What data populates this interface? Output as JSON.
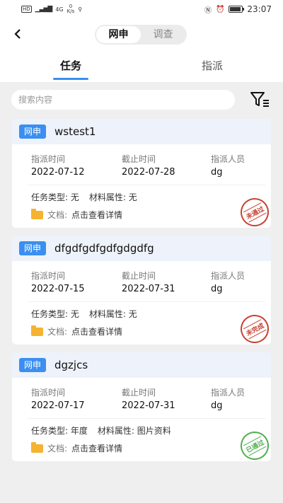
{
  "status_bar": {
    "hd": "HD",
    "signal": "4G",
    "speed": "0\nK/s",
    "time": "23:07"
  },
  "nav": {
    "back_icon": "chevron-left-icon",
    "segments": [
      "网申",
      "调查"
    ],
    "active_segment": 0
  },
  "tabs": [
    "任务",
    "指派"
  ],
  "search": {
    "placeholder": "搜索内容",
    "value": ""
  },
  "labels": {
    "assign_time": "指派时间",
    "deadline": "截止时间",
    "assignee": "指派人员",
    "task_type": "任务类型:",
    "material_attr": "材料属性:",
    "doc": "文档:",
    "doc_link": "点击查看详情"
  },
  "cards": [
    {
      "badge": "网申",
      "title": "wstest1",
      "assign_time": "2022-07-12",
      "deadline": "2022-07-28",
      "assignee": "dg",
      "task_type": "无",
      "material_attr": "无",
      "stamp": "未通过",
      "stamp_color": "#c84032"
    },
    {
      "badge": "网申",
      "title": "dfgdfgdfgdfgdgdfg",
      "assign_time": "2022-07-15",
      "deadline": "2022-07-31",
      "assignee": "dg",
      "task_type": "无",
      "material_attr": "无",
      "stamp": "未完成",
      "stamp_color": "#c84032"
    },
    {
      "badge": "网申",
      "title": "dgzjcs",
      "assign_time": "2022-07-17",
      "deadline": "2022-07-31",
      "assignee": "dg",
      "task_type": "年度",
      "material_attr": "图片资料",
      "stamp": "已通过",
      "stamp_color": "#4fae4f"
    }
  ],
  "colors": {
    "accent": "#3b8ff0",
    "folder": "#f5b331"
  }
}
